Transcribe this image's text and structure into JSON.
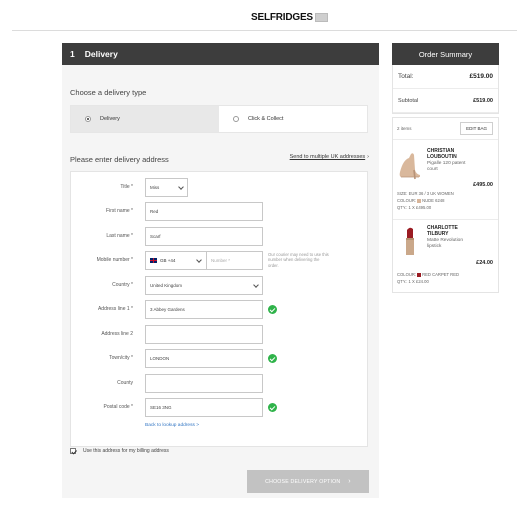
{
  "brand": {
    "logo_text": "SELFRIDGES"
  },
  "delivery": {
    "step_number": "1",
    "step_title": "Delivery",
    "type_heading": "Choose a delivery type",
    "types": [
      {
        "label": "Delivery",
        "selected": true
      },
      {
        "label": "Click & Collect",
        "selected": false
      }
    ],
    "address_heading": "Please enter delivery address",
    "multi_link": "Send to multiple UK addresses",
    "form": {
      "title": {
        "label": "Title *",
        "value": "Miss"
      },
      "first_name": {
        "label": "First name *",
        "value": "Red"
      },
      "last_name": {
        "label": "Last name *",
        "value": "Scarf"
      },
      "mobile": {
        "label": "Mobile number *",
        "country_code": "GB +44",
        "placeholder": "Number *",
        "note": "Our courier may need to use this number when delivering the order."
      },
      "country": {
        "label": "Country *",
        "value": "United Kingdom"
      },
      "address1": {
        "label": "Address line 1 *",
        "value": "3 Abbey Gardens"
      },
      "address2": {
        "label": "Address line 2",
        "value": ""
      },
      "town": {
        "label": "Town/city *",
        "value": "LONDON"
      },
      "county": {
        "label": "County",
        "value": ""
      },
      "postal": {
        "label": "Postal code *",
        "value": "SE16 3NG"
      },
      "lookup_link": "Back to lookup address >"
    },
    "billing_label": "Use this address for my billing address",
    "cta_label": "CHOOSE DELIVERY OPTION"
  },
  "summary": {
    "title": "Order Summary",
    "total_label": "Total:",
    "total_value": "£519.00",
    "subtotal_label": "Subtotal",
    "subtotal_value": "£519.00",
    "items_count": "2 items",
    "edit_bag": "EDIT BAG",
    "items": [
      {
        "brand_line1": "CHRISTIAN",
        "brand_line2": "LOUBOUTIN",
        "desc_line1": "Pigalle 120 patent",
        "desc_line2": "court",
        "price": "£495.00",
        "size": "SIZE: EUR 36 / 3 UK WOMEN",
        "colour_label": "COLOUR:",
        "colour_value": "NUDE 6248",
        "colour_hex": "#d8b59a",
        "qty": "QTY.: 1 X £495.00"
      },
      {
        "brand_line1": "CHARLOTTE",
        "brand_line2": "TILBURY",
        "desc_line1": "Matte Revolution",
        "desc_line2": "lipstick",
        "price": "£24.00",
        "colour_label": "COLOUR:",
        "colour_value": "RED CARPET RED",
        "colour_hex": "#9a1b22",
        "qty": "QTY.: 1 X £24.00"
      }
    ]
  }
}
